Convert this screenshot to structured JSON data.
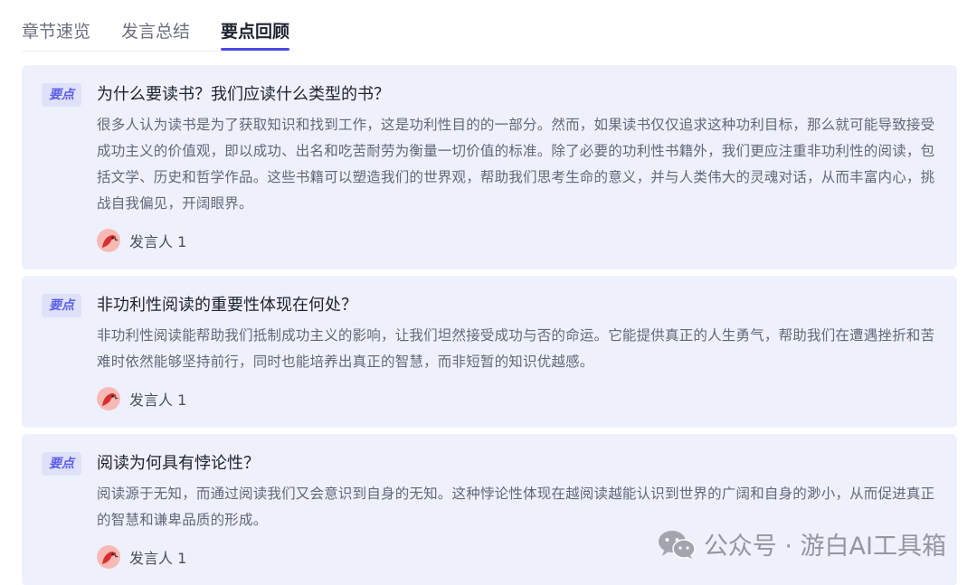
{
  "tabs": [
    {
      "label": "章节速览",
      "active": false
    },
    {
      "label": "发言总结",
      "active": false
    },
    {
      "label": "要点回顾",
      "active": true
    }
  ],
  "colors": {
    "accent": "#4b4de2",
    "card_bg": "#eef0fb",
    "badge_bg": "#dfe1f9",
    "badge_text": "#5b5ee8"
  },
  "cards": [
    {
      "badge": "要点",
      "title": "为什么要读书？我们应读什么类型的书？",
      "body": "很多人认为读书是为了获取知识和找到工作，这是功利性目的的一部分。然而，如果读书仅仅追求这种功利目标，那么就可能导致接受成功主义的价值观，即以成功、出名和吃苦耐劳为衡量一切价值的标准。除了必要的功利性书籍外，我们更应注重非功利性的阅读，包括文学、历史和哲学作品。这些书籍可以塑造我们的世界观，帮助我们思考生命的意义，并与人类伟大的灵魂对话，从而丰富内心，挑战自我偏见，开阔眼界。",
      "speaker": "发言人 1"
    },
    {
      "badge": "要点",
      "title": "非功利性阅读的重要性体现在何处？",
      "body": "非功利性阅读能帮助我们抵制成功主义的影响，让我们坦然接受成功与否的命运。它能提供真正的人生勇气，帮助我们在遭遇挫折和苦难时依然能够坚持前行，同时也能培养出真正的智慧，而非短暂的知识优越感。",
      "speaker": "发言人 1"
    },
    {
      "badge": "要点",
      "title": "阅读为何具有悖论性？",
      "body": "阅读源于无知，而通过阅读我们又会意识到自身的无知。这种悖论性体现在越阅读越能认识到世界的广阔和自身的渺小，从而促进真正的智慧和谦卑品质的形成。",
      "speaker": "发言人 1"
    }
  ],
  "watermark": {
    "text": "公众号 · 游白AI工具箱",
    "icon": "wechat-icon"
  }
}
